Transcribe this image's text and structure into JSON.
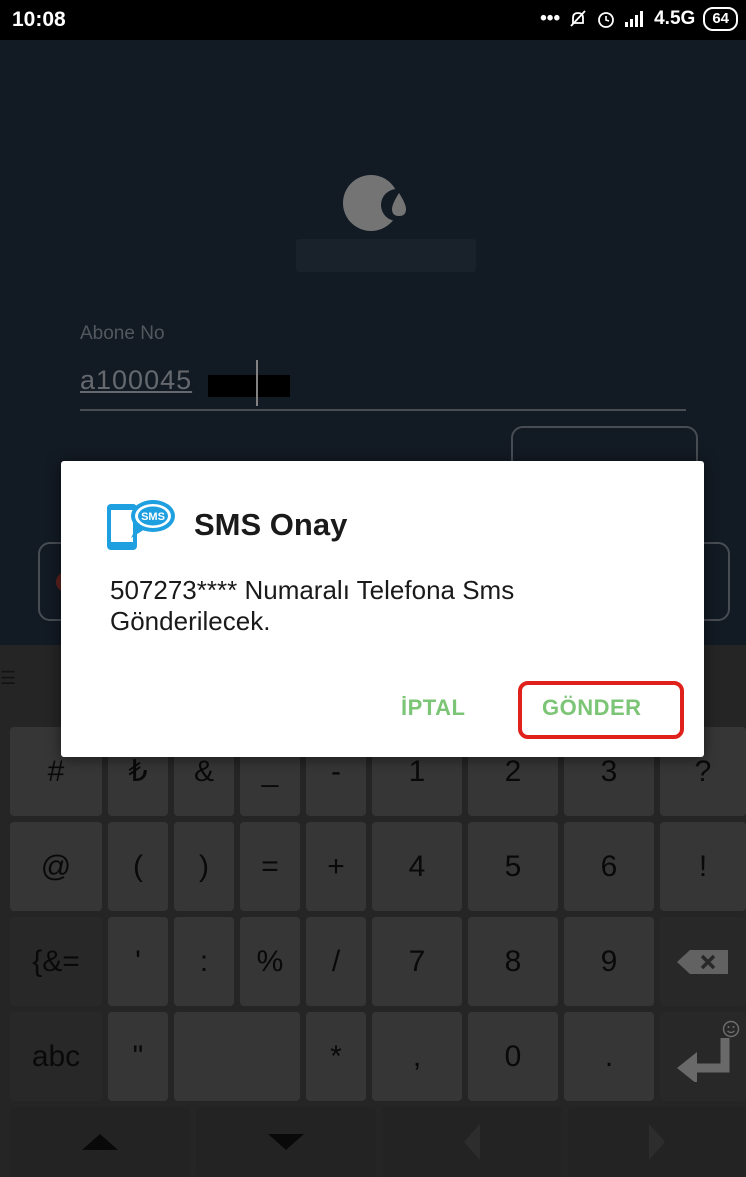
{
  "status_bar": {
    "time": "10:08",
    "network": "4.5G",
    "battery": "64",
    "icons": [
      "more-dots-icon",
      "mute-bell-icon",
      "alarm-icon",
      "signal-icon",
      "battery-icon"
    ]
  },
  "login_form": {
    "field_label": "Abone No",
    "field_value": "a100045"
  },
  "dialog": {
    "title": "SMS Onay",
    "message": "507273**** Numaralı Telefona Sms Gönderilecek.",
    "cancel_label": "İPTAL",
    "send_label": "GÖNDER",
    "accent": "#7cc576",
    "highlight": "#e0201b"
  },
  "keyboard": {
    "rows": [
      [
        "#",
        "₺",
        "&",
        "_",
        "-",
        "1",
        "2",
        "3",
        "?"
      ],
      [
        "@",
        "(",
        ")",
        "=",
        "+",
        "4",
        "5",
        "6",
        "!"
      ],
      [
        "{&=",
        "'",
        ":",
        "%",
        "/",
        "7",
        "8",
        "9"
      ],
      [
        "abc",
        "\"",
        "*",
        ",",
        "0",
        "."
      ]
    ]
  }
}
